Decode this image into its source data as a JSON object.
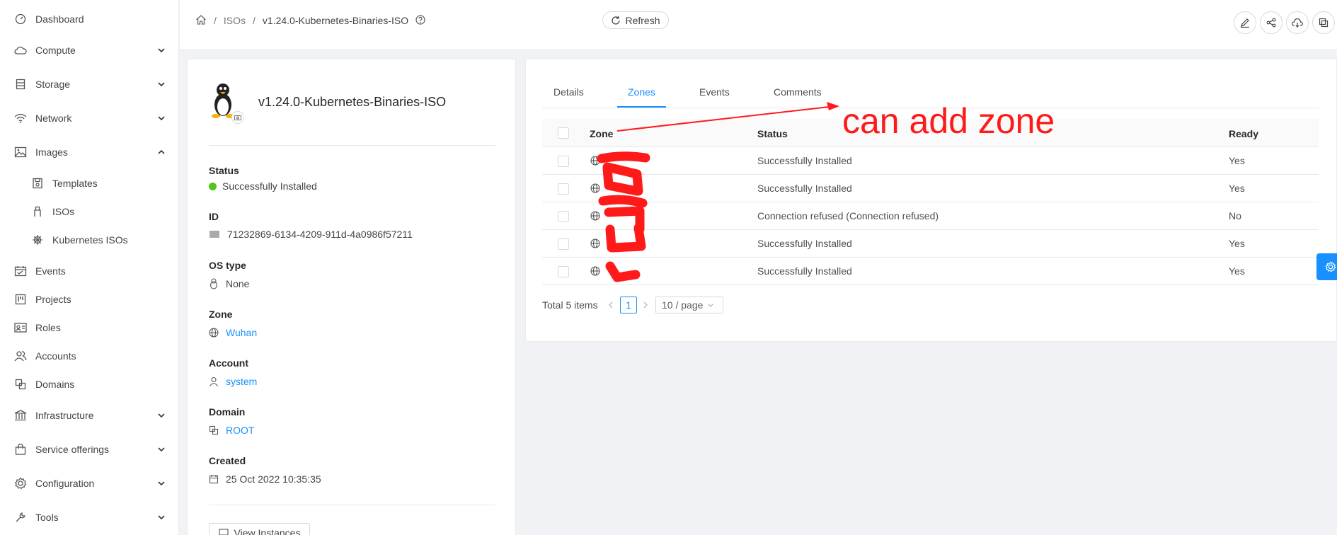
{
  "sidebar": {
    "items": [
      {
        "label": "Dashboard",
        "icon": "dashboard-icon"
      },
      {
        "label": "Compute",
        "icon": "cloud-icon",
        "expandable": true
      },
      {
        "label": "Storage",
        "icon": "database-icon",
        "expandable": true
      },
      {
        "label": "Network",
        "icon": "wifi-icon",
        "expandable": true
      },
      {
        "label": "Images",
        "icon": "picture-icon",
        "expanded": true
      },
      {
        "label": "Templates",
        "icon": "save-icon",
        "sub": true
      },
      {
        "label": "ISOs",
        "icon": "usb-icon",
        "sub": true
      },
      {
        "label": "Kubernetes ISOs",
        "icon": "helm-icon",
        "sub": true
      },
      {
        "label": "Events",
        "icon": "schedule-icon"
      },
      {
        "label": "Projects",
        "icon": "project-icon"
      },
      {
        "label": "Roles",
        "icon": "idcard-icon"
      },
      {
        "label": "Accounts",
        "icon": "team-icon"
      },
      {
        "label": "Domains",
        "icon": "block-icon"
      },
      {
        "label": "Infrastructure",
        "icon": "bank-icon",
        "expandable": true
      },
      {
        "label": "Service offerings",
        "icon": "shopping-icon",
        "expandable": true
      },
      {
        "label": "Configuration",
        "icon": "setting-icon",
        "expandable": true
      },
      {
        "label": "Tools",
        "icon": "tool-icon",
        "expandable": true
      }
    ]
  },
  "header": {
    "breadcrumb": [
      "ISOs",
      "v1.24.0-Kubernetes-Binaries-ISO"
    ],
    "separator": "/",
    "refresh_label": "Refresh",
    "actions": [
      "edit-icon",
      "share-icon",
      "cloud-download-icon",
      "copy-icon"
    ]
  },
  "resource": {
    "name": "v1.24.0-Kubernetes-Binaries-ISO",
    "status_label": "Status",
    "status_value": "Successfully Installed",
    "id_label": "ID",
    "id_value": "71232869-6134-4209-911d-4a0986f57211",
    "ostype_label": "OS type",
    "ostype_value": "None",
    "zone_label": "Zone",
    "zone_value": "Wuhan",
    "account_label": "Account",
    "account_value": "system",
    "domain_label": "Domain",
    "domain_value": "ROOT",
    "created_label": "Created",
    "created_value": "25 Oct 2022 10:35:35",
    "view_instances_label": "View Instances"
  },
  "tabs": [
    "Details",
    "Zones",
    "Events",
    "Comments"
  ],
  "active_tab": "Zones",
  "table": {
    "columns": [
      "Zone",
      "Status",
      "Ready"
    ],
    "rows": [
      {
        "status": "Successfully Installed",
        "ready": "Yes"
      },
      {
        "status": "Successfully Installed",
        "ready": "Yes"
      },
      {
        "status": "Connection refused (Connection refused)",
        "ready": "No"
      },
      {
        "status": "Successfully Installed",
        "ready": "Yes"
      },
      {
        "status": "Successfully Installed",
        "ready": "Yes"
      }
    ]
  },
  "pagination": {
    "total": "Total 5 items",
    "current": "1",
    "page_size": "10 / page"
  },
  "annotation": {
    "text": "can add zone",
    "color": "#ff1a1a"
  },
  "colors": {
    "accent": "#1890ff",
    "success": "#52c41a"
  }
}
